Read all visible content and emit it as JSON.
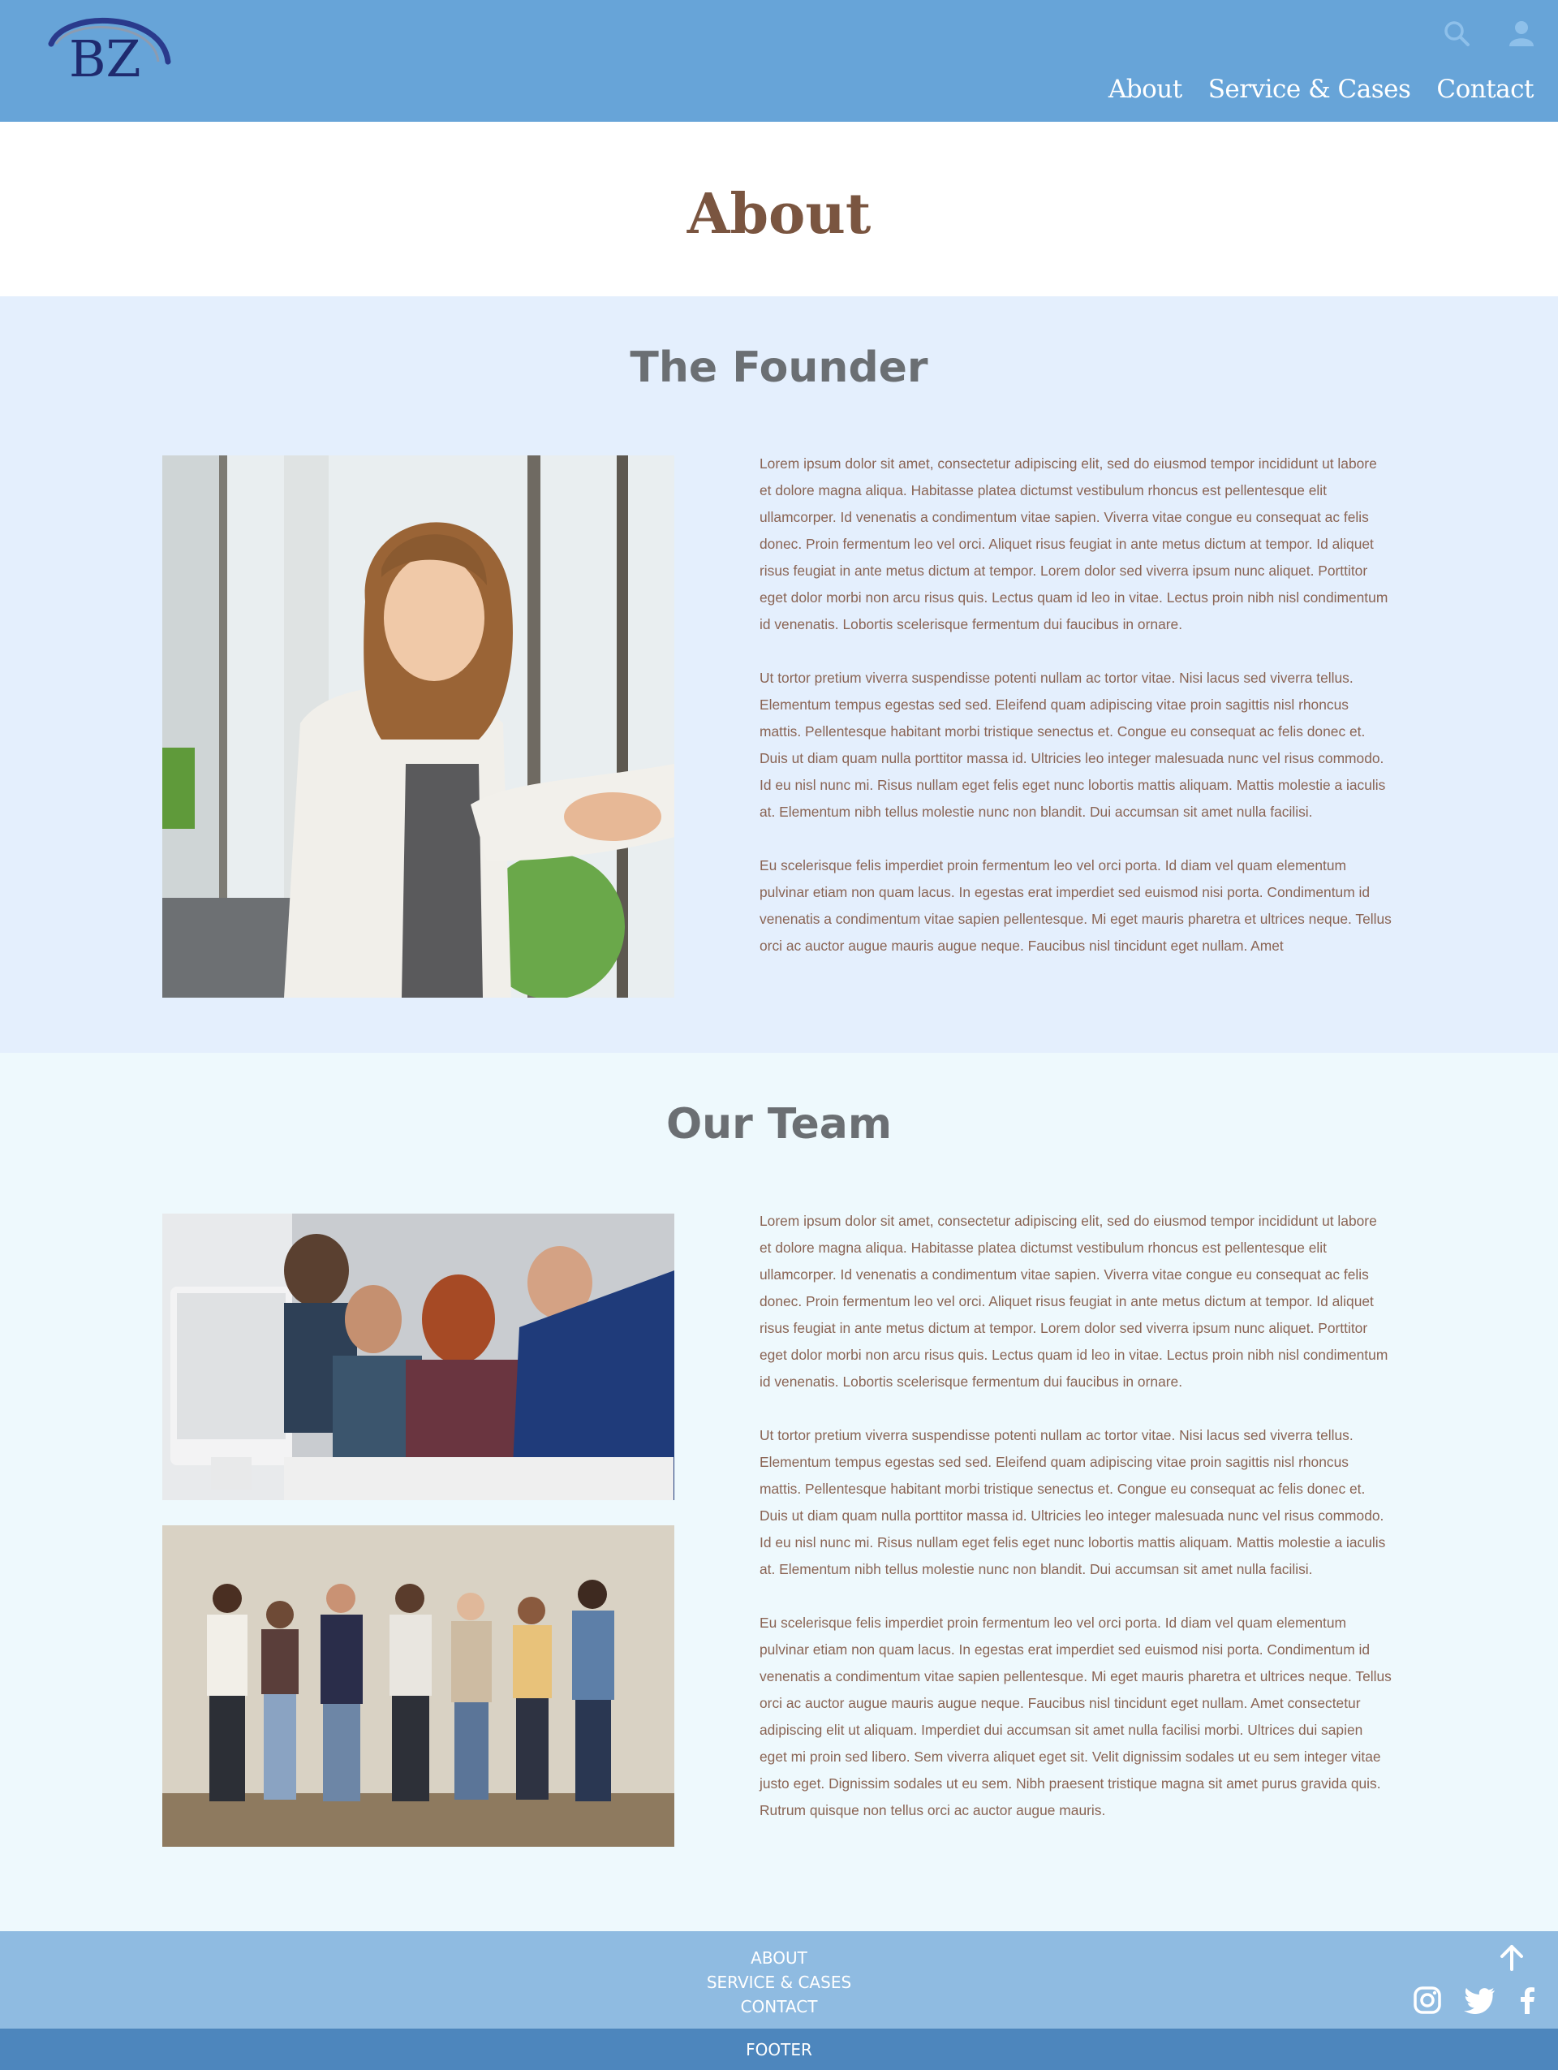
{
  "colors": {
    "header_bg": "#67a4d8",
    "founder_bg": "#e4effd",
    "team_bg": "#eef9fd",
    "footer_bg": "#8fbbe1",
    "bottom_bar_bg": "#4d86bd",
    "title_color": "#7a5540",
    "body_text_color": "#8a6454"
  },
  "header": {
    "logo_text": "BZ",
    "icons": [
      "search-icon",
      "user-icon"
    ],
    "nav": [
      "About",
      "Service & Cases",
      "Contact"
    ]
  },
  "page_title": "About",
  "founder": {
    "title": "The Founder",
    "paragraphs": [
      "Lorem ipsum dolor sit amet, consectetur adipiscing elit, sed do eiusmod tempor incididunt ut labore et dolore magna aliqua. Habitasse platea dictumst vestibulum rhoncus est pellentesque elit ullamcorper. Id venenatis a condimentum vitae sapien. Viverra vitae congue eu consequat ac felis donec. Proin fermentum leo vel orci. Aliquet risus feugiat in ante metus dictum at tempor. Id aliquet risus feugiat in ante metus dictum at tempor. Lorem dolor sed viverra ipsum nunc aliquet. Porttitor eget dolor morbi non arcu risus quis. Lectus quam id leo in vitae. Lectus proin nibh nisl condimentum id venenatis. Lobortis scelerisque fermentum dui faucibus in ornare.",
      "Ut tortor pretium viverra suspendisse potenti nullam ac tortor vitae. Nisi lacus sed viverra tellus. Elementum tempus egestas sed sed. Eleifend quam adipiscing vitae proin sagittis nisl rhoncus mattis. Pellentesque habitant morbi tristique senectus et. Congue eu consequat ac felis donec et. Duis ut diam quam nulla porttitor massa id. Ultricies leo integer malesuada nunc vel risus commodo. Id eu nisl nunc mi. Risus nullam eget felis eget nunc lobortis mattis aliquam. Mattis molestie a iaculis at. Elementum nibh tellus molestie nunc non blandit. Dui accumsan sit amet nulla facilisi.",
      "Eu scelerisque felis imperdiet proin fermentum leo vel orci porta. Id diam vel quam elementum pulvinar etiam non quam lacus. In egestas erat imperdiet sed euismod nisi porta. Condimentum id venenatis a condimentum vitae sapien pellentesque. Mi eget mauris pharetra et ultrices neque. Tellus orci ac auctor augue mauris augue neque. Faucibus nisl tincidunt eget nullam. Amet"
    ]
  },
  "team": {
    "title": "Our Team",
    "paragraphs": [
      "Lorem ipsum dolor sit amet, consectetur adipiscing elit, sed do eiusmod tempor incididunt ut labore et dolore magna aliqua. Habitasse platea dictumst vestibulum rhoncus est pellentesque elit ullamcorper. Id venenatis a condimentum vitae sapien. Viverra vitae congue eu consequat ac felis donec. Proin fermentum leo vel orci. Aliquet risus feugiat in ante metus dictum at tempor. Id aliquet risus feugiat in ante metus dictum at tempor. Lorem dolor sed viverra ipsum nunc aliquet. Porttitor eget dolor morbi non arcu risus quis. Lectus quam id leo in vitae. Lectus proin nibh nisl condimentum id venenatis. Lobortis scelerisque fermentum dui faucibus in ornare.",
      "Ut tortor pretium viverra suspendisse potenti nullam ac tortor vitae. Nisi lacus sed viverra tellus. Elementum tempus egestas sed sed. Eleifend quam adipiscing vitae proin sagittis nisl rhoncus mattis. Pellentesque habitant morbi tristique senectus et. Congue eu consequat ac felis donec et. Duis ut diam quam nulla porttitor massa id. Ultricies leo integer malesuada nunc vel risus commodo. Id eu nisl nunc mi. Risus nullam eget felis eget nunc lobortis mattis aliquam. Mattis molestie a iaculis at. Elementum nibh tellus molestie nunc non blandit. Dui accumsan sit amet nulla facilisi.",
      "Eu scelerisque felis imperdiet proin fermentum leo vel orci porta. Id diam vel quam elementum pulvinar etiam non quam lacus. In egestas erat imperdiet sed euismod nisi porta. Condimentum id venenatis a condimentum vitae sapien pellentesque. Mi eget mauris pharetra et ultrices neque. Tellus orci ac auctor augue mauris augue neque. Faucibus nisl tincidunt eget nullam. Amet consectetur adipiscing elit ut aliquam. Imperdiet dui accumsan sit amet nulla facilisi morbi. Ultrices dui sapien eget mi proin sed libero. Sem viverra aliquet eget sit. Velit dignissim sodales ut eu sem integer vitae justo eget. Dignissim sodales ut eu sem. Nibh praesent tristique magna sit amet purus gravida quis. Rutrum quisque non tellus orci ac auctor augue mauris."
    ]
  },
  "footer": {
    "links": [
      "ABOUT",
      "SERVICE & CASES",
      "CONTACT"
    ],
    "icons": [
      "arrow-up-icon",
      "instagram-icon",
      "twitter-icon",
      "facebook-icon"
    ],
    "bottom_label": "FOOTER"
  }
}
